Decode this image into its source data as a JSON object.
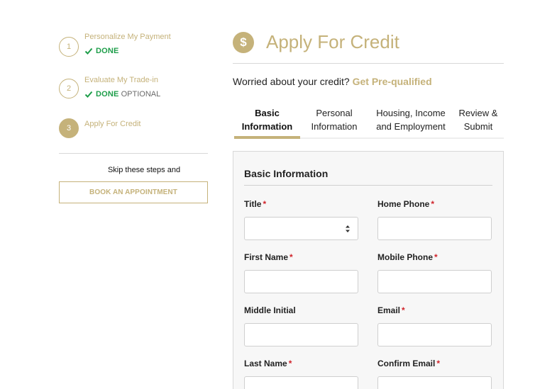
{
  "stepper": {
    "steps": [
      {
        "number": "1",
        "title": "Personalize My Payment",
        "status": "DONE",
        "optional": ""
      },
      {
        "number": "2",
        "title": "Evaluate My Trade-in",
        "status": "DONE",
        "optional": "OPTIONAL"
      },
      {
        "number": "3",
        "title": "Apply For Credit",
        "status": "",
        "optional": ""
      }
    ],
    "skip_text": "Skip these steps and",
    "book_button": "BOOK AN APPOINTMENT"
  },
  "header": {
    "icon": "dollar-icon",
    "title": "Apply For Credit",
    "worried_text": "Worried about your credit?",
    "prequal_link": "Get Pre-qualified"
  },
  "tabs": [
    {
      "line1": "Basic",
      "line2": "Information",
      "active": true
    },
    {
      "line1": "Personal",
      "line2": "Information",
      "active": false
    },
    {
      "line1": "Housing, Income",
      "line2": "and Employment",
      "active": false
    },
    {
      "line1": "Review &",
      "line2": "Submit",
      "active": false
    }
  ],
  "form": {
    "section_title": "Basic Information",
    "fields": {
      "title": {
        "label": "Title",
        "required": "*",
        "value": ""
      },
      "home_phone": {
        "label": "Home Phone",
        "required": "*",
        "value": ""
      },
      "first_name": {
        "label": "First Name",
        "required": "*",
        "value": ""
      },
      "mobile_phone": {
        "label": "Mobile Phone",
        "required": "*",
        "value": ""
      },
      "middle_initial": {
        "label": "Middle Initial",
        "required": "",
        "value": ""
      },
      "email": {
        "label": "Email",
        "required": "*",
        "value": ""
      },
      "last_name": {
        "label": "Last Name",
        "required": "*",
        "value": ""
      },
      "confirm_email": {
        "label": "Confirm Email",
        "required": "*",
        "value": ""
      }
    }
  },
  "colors": {
    "accent": "#c5b27a",
    "done_green": "#1e9e4a",
    "required_red": "#d0242b"
  }
}
